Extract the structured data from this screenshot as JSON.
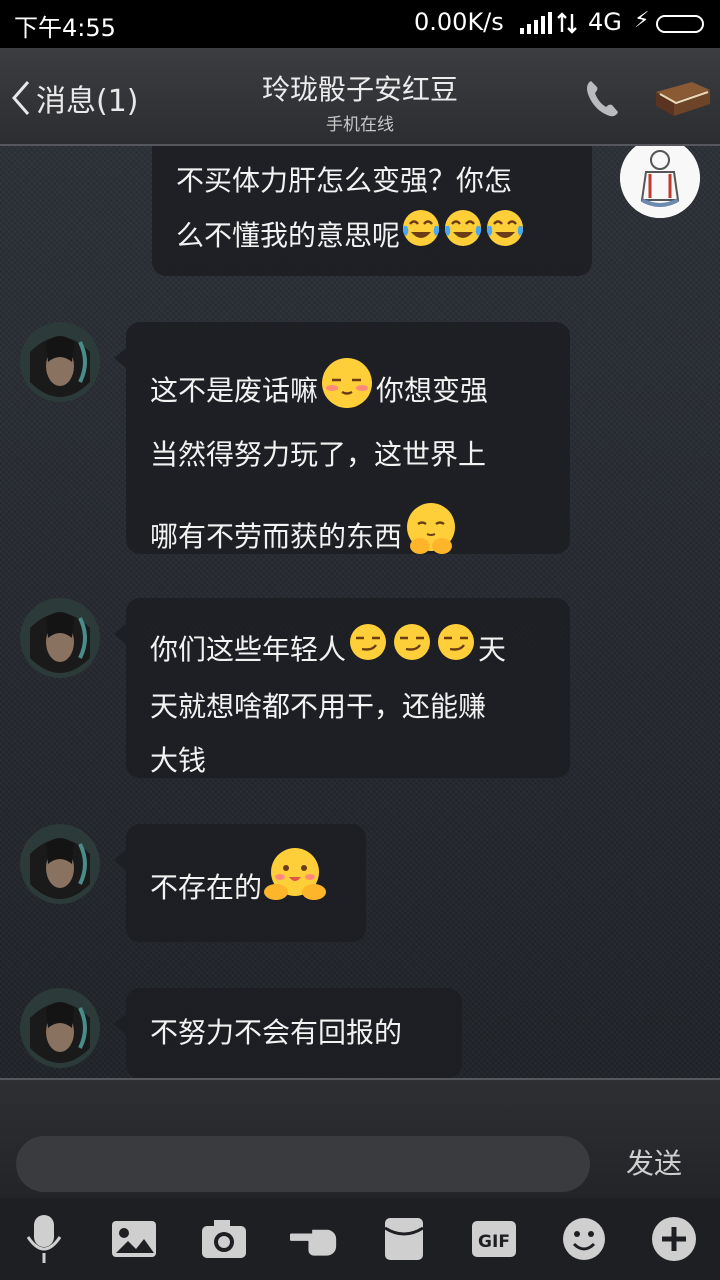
{
  "status_bar": {
    "time": "下午4:55",
    "network_speed": "0.00K/s",
    "network_type": "4G"
  },
  "header": {
    "back_label": "消息(1)",
    "title": "玲珑骰子安红豆",
    "subtitle": "手机在线",
    "icons": [
      "phone-icon",
      "profile-book-icon"
    ]
  },
  "messages": [
    {
      "sender": "self",
      "lines": [
        "不买体力肝怎么变强？你怎",
        "么不懂我的意思呢"
      ],
      "emoji_after": [
        "tears-of-joy",
        "tears-of-joy",
        "tears-of-joy"
      ]
    },
    {
      "sender": "friend",
      "parts": [
        "这不是废话嘛",
        "你想变强",
        "当然得努力玩了，这世界上",
        "哪有不劳而获的东西"
      ],
      "emojis": [
        "smug-blush",
        "sweat-hug"
      ]
    },
    {
      "sender": "friend",
      "parts": [
        "你们这些年轻人",
        "天",
        "天就想啥都不用干，还能赚",
        "大钱"
      ],
      "emojis": [
        "smirk",
        "smirk",
        "smirk"
      ]
    },
    {
      "sender": "friend",
      "parts": [
        "不存在的"
      ],
      "emojis": [
        "cute-hug"
      ]
    },
    {
      "sender": "friend",
      "parts": [
        "不努力不会有回报的"
      ]
    }
  ],
  "input": {
    "placeholder": "",
    "send_label": "发送"
  },
  "toolbar": [
    "mic-icon",
    "photo-album-icon",
    "camera-icon",
    "poke-icon",
    "red-packet-icon",
    "gif-icon",
    "emoji-icon",
    "plus-icon"
  ],
  "colors": {
    "bubble": "#1c1e22",
    "header": "#3c3d41",
    "text": "#f2f2f2",
    "emoji_yellow": "#ffcf3a"
  }
}
